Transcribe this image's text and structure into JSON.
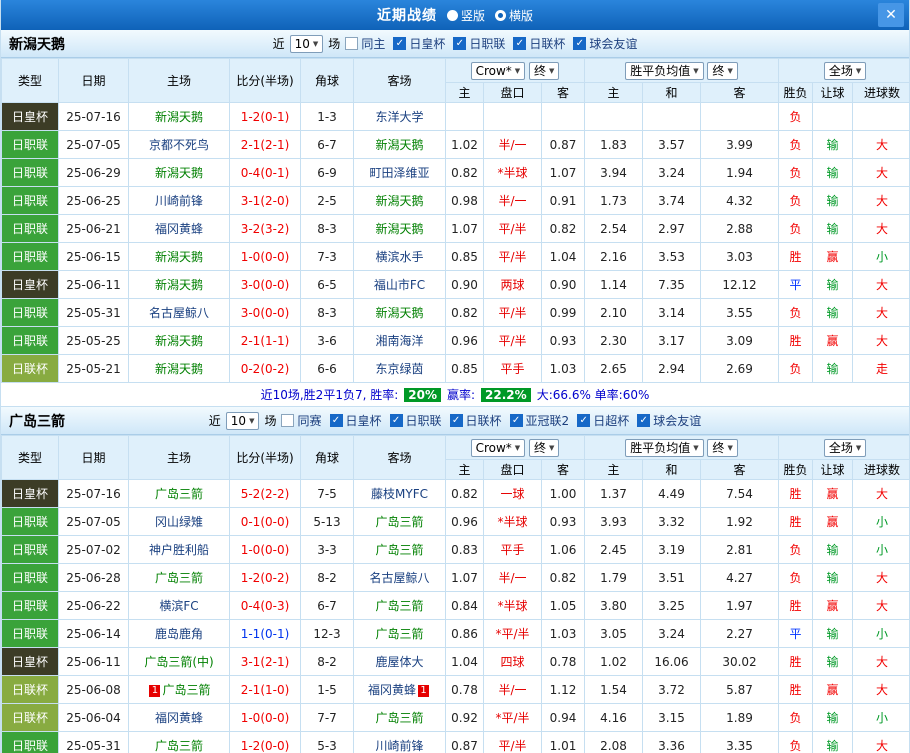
{
  "topbar": {
    "title": "近期战绩",
    "options": [
      {
        "label": "竖版",
        "selected": false
      },
      {
        "label": "横版",
        "selected": true
      }
    ]
  },
  "icons": {
    "close": "✕",
    "check": "✓",
    "dropdown_arrow": "▼"
  },
  "columns": {
    "type": "类型",
    "date": "日期",
    "home": "主场",
    "score": "比分(半场)",
    "corner": "角球",
    "away": "客场",
    "dd_company": "Crow*",
    "dd_final": "终",
    "dd_avg": "胜平负均值",
    "dd_scope": "全场",
    "sub": [
      "主",
      "盘口",
      "客",
      "主",
      "和",
      "客",
      "胜负",
      "让球",
      "进球数"
    ]
  },
  "sections": [
    {
      "team": "新潟天鹅",
      "filters": {
        "prefix": "近",
        "count": "10",
        "suffix": "场",
        "items": [
          {
            "label": "同主",
            "checked": false
          },
          {
            "label": "日皇杯",
            "checked": true
          },
          {
            "label": "日职联",
            "checked": true
          },
          {
            "label": "日联杯",
            "checked": true
          },
          {
            "label": "球会友谊",
            "checked": true
          }
        ]
      },
      "rows": [
        {
          "type": "日皇杯",
          "tcls": "t-cup",
          "date": "25-07-16",
          "home": {
            "t": "新潟天鹅",
            "self": true
          },
          "score": {
            "t": "1-2(0-1)",
            "c": "red"
          },
          "corner": "1-3",
          "away": {
            "t": "东洋大学",
            "self": false
          },
          "odds": [
            "",
            "",
            ""
          ],
          "avg": [
            "",
            "",
            ""
          ],
          "res": [
            [
              "负",
              "red"
            ],
            [
              "",
              ""
            ],
            [
              "",
              ""
            ]
          ]
        },
        {
          "type": "日职联",
          "tcls": "t-league",
          "date": "25-07-05",
          "home": {
            "t": "京都不死鸟",
            "self": false
          },
          "score": {
            "t": "2-1(2-1)",
            "c": "red"
          },
          "corner": "6-7",
          "away": {
            "t": "新潟天鹅",
            "self": true
          },
          "odds": [
            "1.02",
            "半/一",
            "0.87"
          ],
          "avg": [
            "1.83",
            "3.57",
            "3.99"
          ],
          "res": [
            [
              "负",
              "red"
            ],
            [
              "输",
              "green"
            ],
            [
              "大",
              "red"
            ]
          ]
        },
        {
          "type": "日职联",
          "tcls": "t-league",
          "date": "25-06-29",
          "home": {
            "t": "新潟天鹅",
            "self": true
          },
          "score": {
            "t": "0-4(0-1)",
            "c": "red"
          },
          "corner": "6-9",
          "away": {
            "t": "町田泽维亚",
            "self": false
          },
          "odds": [
            "0.82",
            "*半球",
            "1.07"
          ],
          "avg": [
            "3.94",
            "3.24",
            "1.94"
          ],
          "res": [
            [
              "负",
              "red"
            ],
            [
              "输",
              "green"
            ],
            [
              "大",
              "red"
            ]
          ]
        },
        {
          "type": "日职联",
          "tcls": "t-league",
          "date": "25-06-25",
          "home": {
            "t": "川崎前锋",
            "self": false
          },
          "score": {
            "t": "3-1(2-0)",
            "c": "red"
          },
          "corner": "2-5",
          "away": {
            "t": "新潟天鹅",
            "self": true
          },
          "odds": [
            "0.98",
            "半/一",
            "0.91"
          ],
          "avg": [
            "1.73",
            "3.74",
            "4.32"
          ],
          "res": [
            [
              "负",
              "red"
            ],
            [
              "输",
              "green"
            ],
            [
              "大",
              "red"
            ]
          ]
        },
        {
          "type": "日职联",
          "tcls": "t-league",
          "date": "25-06-21",
          "home": {
            "t": "福冈黄蜂",
            "self": false
          },
          "score": {
            "t": "3-2(3-2)",
            "c": "red"
          },
          "corner": "8-3",
          "away": {
            "t": "新潟天鹅",
            "self": true
          },
          "odds": [
            "1.07",
            "平/半",
            "0.82"
          ],
          "avg": [
            "2.54",
            "2.97",
            "2.88"
          ],
          "res": [
            [
              "负",
              "red"
            ],
            [
              "输",
              "green"
            ],
            [
              "大",
              "red"
            ]
          ]
        },
        {
          "type": "日职联",
          "tcls": "t-league",
          "date": "25-06-15",
          "home": {
            "t": "新潟天鹅",
            "self": true
          },
          "score": {
            "t": "1-0(0-0)",
            "c": "red"
          },
          "corner": "7-3",
          "away": {
            "t": "横滨水手",
            "self": false
          },
          "odds": [
            "0.85",
            "平/半",
            "1.04"
          ],
          "avg": [
            "2.16",
            "3.53",
            "3.03"
          ],
          "res": [
            [
              "胜",
              "red"
            ],
            [
              "赢",
              "red"
            ],
            [
              "小",
              "green"
            ]
          ]
        },
        {
          "type": "日皇杯",
          "tcls": "t-cup",
          "date": "25-06-11",
          "home": {
            "t": "新潟天鹅",
            "self": true
          },
          "score": {
            "t": "3-0(0-0)",
            "c": "red"
          },
          "corner": "6-5",
          "away": {
            "t": "福山市FC",
            "self": false
          },
          "odds": [
            "0.90",
            "两球",
            "0.90"
          ],
          "avg": [
            "1.14",
            "7.35",
            "12.12"
          ],
          "res": [
            [
              "平",
              "blue"
            ],
            [
              "输",
              "green"
            ],
            [
              "大",
              "red"
            ]
          ]
        },
        {
          "type": "日职联",
          "tcls": "t-league",
          "date": "25-05-31",
          "home": {
            "t": "名古屋鲸八",
            "self": false
          },
          "score": {
            "t": "3-0(0-0)",
            "c": "red"
          },
          "corner": "8-3",
          "away": {
            "t": "新潟天鹅",
            "self": true
          },
          "odds": [
            "0.82",
            "平/半",
            "0.99"
          ],
          "avg": [
            "2.10",
            "3.14",
            "3.55"
          ],
          "res": [
            [
              "负",
              "red"
            ],
            [
              "输",
              "green"
            ],
            [
              "大",
              "red"
            ]
          ]
        },
        {
          "type": "日职联",
          "tcls": "t-league",
          "date": "25-05-25",
          "home": {
            "t": "新潟天鹅",
            "self": true
          },
          "score": {
            "t": "2-1(1-1)",
            "c": "red"
          },
          "corner": "3-6",
          "away": {
            "t": "湘南海洋",
            "self": false
          },
          "odds": [
            "0.96",
            "平/半",
            "0.93"
          ],
          "avg": [
            "2.30",
            "3.17",
            "3.09"
          ],
          "res": [
            [
              "胜",
              "red"
            ],
            [
              "赢",
              "red"
            ],
            [
              "大",
              "red"
            ]
          ]
        },
        {
          "type": "日联杯",
          "tcls": "t-lcup",
          "date": "25-05-21",
          "home": {
            "t": "新潟天鹅",
            "self": true
          },
          "score": {
            "t": "0-2(0-2)",
            "c": "red"
          },
          "corner": "6-6",
          "away": {
            "t": "东京绿茵",
            "self": false
          },
          "odds": [
            "0.85",
            "平手",
            "1.03"
          ],
          "avg": [
            "2.65",
            "2.94",
            "2.69"
          ],
          "res": [
            [
              "负",
              "red"
            ],
            [
              "输",
              "green"
            ],
            [
              "走",
              "red"
            ]
          ]
        }
      ],
      "summary": {
        "text": "近10场,胜2平1负7, 胜率:",
        "win_rate": "20%",
        "cover_label": "赢率:",
        "cover_rate": "22.2%",
        "tail": "大:66.6% 单率:60%"
      }
    },
    {
      "team": "广岛三箭",
      "filters": {
        "prefix": "近",
        "count": "10",
        "suffix": "场",
        "items": [
          {
            "label": "同赛",
            "checked": false
          },
          {
            "label": "日皇杯",
            "checked": true
          },
          {
            "label": "日职联",
            "checked": true
          },
          {
            "label": "日联杯",
            "checked": true
          },
          {
            "label": "亚冠联2",
            "checked": true
          },
          {
            "label": "日超杯",
            "checked": true
          },
          {
            "label": "球会友谊",
            "checked": true
          }
        ]
      },
      "rows": [
        {
          "type": "日皇杯",
          "tcls": "t-cup",
          "date": "25-07-16",
          "home": {
            "t": "广岛三箭",
            "self": true
          },
          "score": {
            "t": "5-2(2-2)",
            "c": "red"
          },
          "corner": "7-5",
          "away": {
            "t": "藤枝MYFC",
            "self": false
          },
          "odds": [
            "0.82",
            "一球",
            "1.00"
          ],
          "avg": [
            "1.37",
            "4.49",
            "7.54"
          ],
          "res": [
            [
              "胜",
              "red"
            ],
            [
              "赢",
              "red"
            ],
            [
              "大",
              "red"
            ]
          ]
        },
        {
          "type": "日职联",
          "tcls": "t-league",
          "date": "25-07-05",
          "home": {
            "t": "冈山绿雉",
            "self": false
          },
          "score": {
            "t": "0-1(0-0)",
            "c": "red"
          },
          "corner": "5-13",
          "away": {
            "t": "广岛三箭",
            "self": true
          },
          "odds": [
            "0.96",
            "*半球",
            "0.93"
          ],
          "avg": [
            "3.93",
            "3.32",
            "1.92"
          ],
          "res": [
            [
              "胜",
              "red"
            ],
            [
              "赢",
              "red"
            ],
            [
              "小",
              "green"
            ]
          ]
        },
        {
          "type": "日职联",
          "tcls": "t-league",
          "date": "25-07-02",
          "home": {
            "t": "神户胜利船",
            "self": false
          },
          "score": {
            "t": "1-0(0-0)",
            "c": "red"
          },
          "corner": "3-3",
          "away": {
            "t": "广岛三箭",
            "self": true
          },
          "odds": [
            "0.83",
            "平手",
            "1.06"
          ],
          "avg": [
            "2.45",
            "3.19",
            "2.81"
          ],
          "res": [
            [
              "负",
              "red"
            ],
            [
              "输",
              "green"
            ],
            [
              "小",
              "green"
            ]
          ]
        },
        {
          "type": "日职联",
          "tcls": "t-league",
          "date": "25-06-28",
          "home": {
            "t": "广岛三箭",
            "self": true
          },
          "score": {
            "t": "1-2(0-2)",
            "c": "red"
          },
          "corner": "8-2",
          "away": {
            "t": "名古屋鲸八",
            "self": false
          },
          "odds": [
            "1.07",
            "半/一",
            "0.82"
          ],
          "avg": [
            "1.79",
            "3.51",
            "4.27"
          ],
          "res": [
            [
              "负",
              "red"
            ],
            [
              "输",
              "green"
            ],
            [
              "大",
              "red"
            ]
          ]
        },
        {
          "type": "日职联",
          "tcls": "t-league",
          "date": "25-06-22",
          "home": {
            "t": "横滨FC",
            "self": false
          },
          "score": {
            "t": "0-4(0-3)",
            "c": "red"
          },
          "corner": "6-7",
          "away": {
            "t": "广岛三箭",
            "self": true
          },
          "odds": [
            "0.84",
            "*半球",
            "1.05"
          ],
          "avg": [
            "3.80",
            "3.25",
            "1.97"
          ],
          "res": [
            [
              "胜",
              "red"
            ],
            [
              "赢",
              "red"
            ],
            [
              "大",
              "red"
            ]
          ]
        },
        {
          "type": "日职联",
          "tcls": "t-league",
          "date": "25-06-14",
          "home": {
            "t": "鹿岛鹿角",
            "self": false
          },
          "score": {
            "t": "1-1(0-1)",
            "c": "blue"
          },
          "corner": "12-3",
          "away": {
            "t": "广岛三箭",
            "self": true
          },
          "odds": [
            "0.86",
            "*平/半",
            "1.03"
          ],
          "avg": [
            "3.05",
            "3.24",
            "2.27"
          ],
          "res": [
            [
              "平",
              "blue"
            ],
            [
              "输",
              "green"
            ],
            [
              "小",
              "green"
            ]
          ]
        },
        {
          "type": "日皇杯",
          "tcls": "t-cup",
          "date": "25-06-11",
          "home": {
            "t": "广岛三箭(中)",
            "self": true
          },
          "score": {
            "t": "3-1(2-1)",
            "c": "red"
          },
          "corner": "8-2",
          "away": {
            "t": "鹿屋体大",
            "self": false
          },
          "odds": [
            "1.04",
            "四球",
            "0.78"
          ],
          "avg": [
            "1.02",
            "16.06",
            "30.02"
          ],
          "res": [
            [
              "胜",
              "red"
            ],
            [
              "输",
              "green"
            ],
            [
              "大",
              "red"
            ]
          ]
        },
        {
          "type": "日联杯",
          "tcls": "t-lcup",
          "date": "25-06-08",
          "home": {
            "t": "广岛三箭",
            "self": true,
            "bl": "1"
          },
          "score": {
            "t": "2-1(1-0)",
            "c": "red"
          },
          "corner": "1-5",
          "away": {
            "t": "福冈黄蜂",
            "self": false,
            "br": "1"
          },
          "odds": [
            "0.78",
            "半/一",
            "1.12"
          ],
          "avg": [
            "1.54",
            "3.72",
            "5.87"
          ],
          "res": [
            [
              "胜",
              "red"
            ],
            [
              "赢",
              "red"
            ],
            [
              "大",
              "red"
            ]
          ]
        },
        {
          "type": "日联杯",
          "tcls": "t-lcup",
          "date": "25-06-04",
          "home": {
            "t": "福冈黄蜂",
            "self": false
          },
          "score": {
            "t": "1-0(0-0)",
            "c": "red"
          },
          "corner": "7-7",
          "away": {
            "t": "广岛三箭",
            "self": true
          },
          "odds": [
            "0.92",
            "*平/半",
            "0.94"
          ],
          "avg": [
            "4.16",
            "3.15",
            "1.89"
          ],
          "res": [
            [
              "负",
              "red"
            ],
            [
              "输",
              "green"
            ],
            [
              "小",
              "green"
            ]
          ]
        },
        {
          "type": "日职联",
          "tcls": "t-league",
          "date": "25-05-31",
          "home": {
            "t": "广岛三箭",
            "self": true
          },
          "score": {
            "t": "1-2(0-0)",
            "c": "red"
          },
          "corner": "5-3",
          "away": {
            "t": "川崎前锋",
            "self": false
          },
          "odds": [
            "0.87",
            "平/半",
            "1.01"
          ],
          "avg": [
            "2.08",
            "3.36",
            "3.35"
          ],
          "res": [
            [
              "负",
              "red"
            ],
            [
              "输",
              "green"
            ],
            [
              "大",
              "red"
            ]
          ]
        }
      ]
    }
  ]
}
